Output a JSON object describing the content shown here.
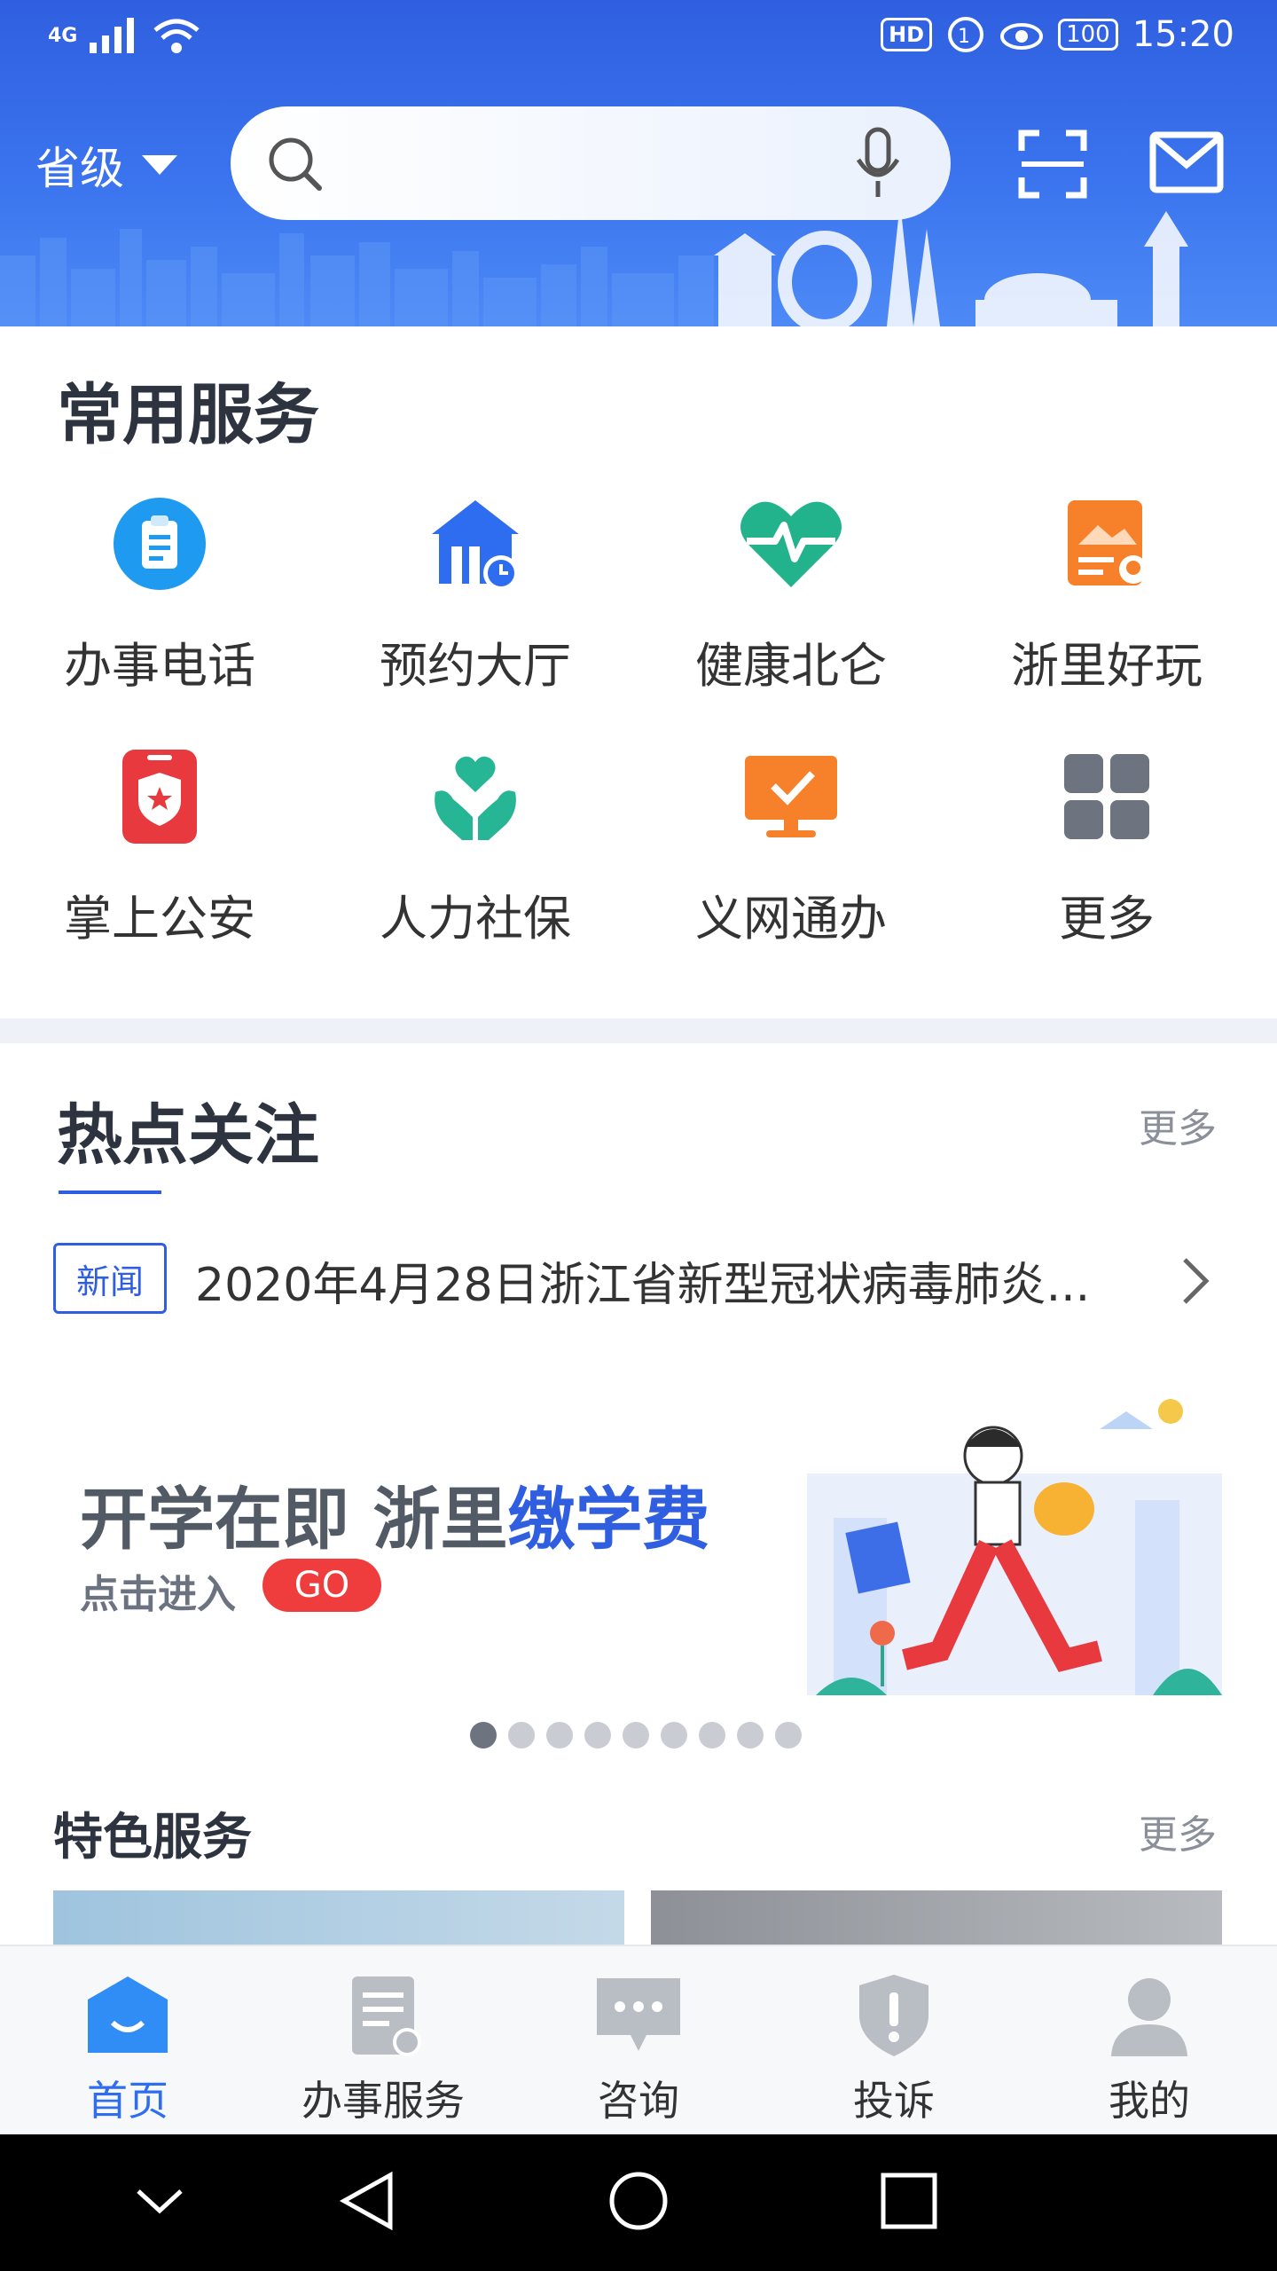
{
  "status_bar": {
    "network": "4G",
    "right_badge": "HD",
    "battery": "100",
    "time": "15:20"
  },
  "header": {
    "region_label": "省级",
    "search_placeholder": ""
  },
  "common_services": {
    "title": "常用服务",
    "items": [
      {
        "label": "办事电话",
        "icon": "clipboard-icon",
        "color": "#1e9bf0"
      },
      {
        "label": "预约大厅",
        "icon": "hall-clock-icon",
        "color": "#2f6df0"
      },
      {
        "label": "健康北仑",
        "icon": "heartbeat-icon",
        "color": "#23b38c"
      },
      {
        "label": "浙里好玩",
        "icon": "map-pin-card-icon",
        "color": "#f7802a"
      },
      {
        "label": "掌上公安",
        "icon": "police-phone-icon",
        "color": "#e8393e"
      },
      {
        "label": "人力社保",
        "icon": "hands-heart-icon",
        "color": "#26b595"
      },
      {
        "label": "义网通办",
        "icon": "monitor-check-icon",
        "color": "#f7802a"
      },
      {
        "label": "更多",
        "icon": "grid-icon",
        "color": "#6e7380"
      }
    ]
  },
  "hot_topics": {
    "title": "热点关注",
    "more": "更多",
    "news_tag": "新闻",
    "news_text": "2020年4月28日浙江省新型冠状病毒肺炎...",
    "banner": {
      "line1_a": "开学在即  浙里",
      "line1_b": "缴学费",
      "line2": "点击进入",
      "go": "GO"
    },
    "dots": 9,
    "active_dot": 0
  },
  "featured": {
    "title": "特色服务",
    "more": "更多"
  },
  "tabbar": {
    "tabs": [
      {
        "label": "首页",
        "icon": "home-icon",
        "active": true
      },
      {
        "label": "办事服务",
        "icon": "service-doc-icon",
        "active": false
      },
      {
        "label": "咨询",
        "icon": "chat-icon",
        "active": false
      },
      {
        "label": "投诉",
        "icon": "shield-alert-icon",
        "active": false
      },
      {
        "label": "我的",
        "icon": "user-icon",
        "active": false
      }
    ]
  },
  "colors": {
    "primary": "#2f5fe0",
    "accent_red": "#ef3d3d"
  }
}
